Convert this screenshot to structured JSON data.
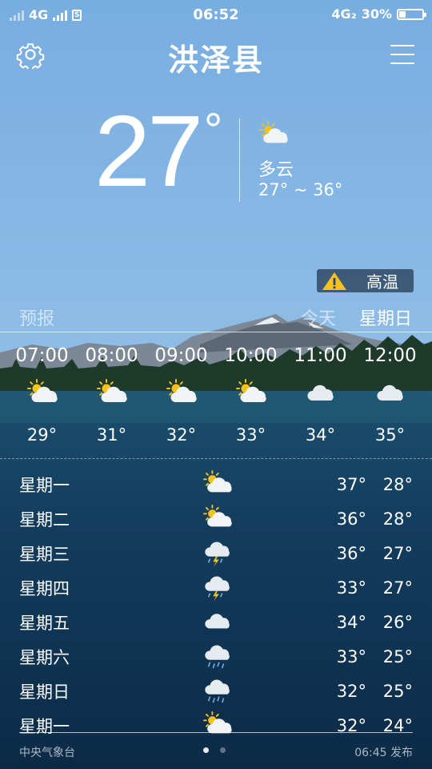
{
  "status": {
    "network_left": "4G",
    "time": "06:52",
    "network_right": "4G₂",
    "battery_percent": "30%",
    "battery_level": 0.3,
    "sim_glyph": "S"
  },
  "header": {
    "city": "洪泽县",
    "settings_icon": "gear-icon",
    "menu_icon": "menu-icon"
  },
  "current": {
    "temp": "27",
    "deg": "°",
    "icon": "partly-cloudy-icon",
    "condition": "多云",
    "range": "27° ~ 36°"
  },
  "alert": {
    "label": "高温",
    "icon": "warning-icon"
  },
  "forecast": {
    "title": "预报",
    "today": "今天",
    "day": "星期日"
  },
  "hourly": [
    {
      "time": "07:00",
      "icon": "partly-cloudy-icon",
      "temp": "29°"
    },
    {
      "time": "08:00",
      "icon": "partly-cloudy-icon",
      "temp": "31°"
    },
    {
      "time": "09:00",
      "icon": "partly-cloudy-icon",
      "temp": "32°"
    },
    {
      "time": "10:00",
      "icon": "partly-cloudy-icon",
      "temp": "33°"
    },
    {
      "time": "11:00",
      "icon": "cloudy-icon",
      "temp": "34°"
    },
    {
      "time": "12:00",
      "icon": "cloudy-icon",
      "temp": "35°"
    }
  ],
  "daily": [
    {
      "day": "星期一",
      "icon": "partly-cloudy-icon",
      "high": "37°",
      "low": "28°"
    },
    {
      "day": "星期二",
      "icon": "partly-cloudy-icon",
      "high": "36°",
      "low": "28°"
    },
    {
      "day": "星期三",
      "icon": "thunderstorm-icon",
      "high": "36°",
      "low": "27°"
    },
    {
      "day": "星期四",
      "icon": "thunderstorm-icon",
      "high": "33°",
      "low": "27°"
    },
    {
      "day": "星期五",
      "icon": "cloudy-icon",
      "high": "34°",
      "low": "26°"
    },
    {
      "day": "星期六",
      "icon": "rain-icon",
      "high": "33°",
      "low": "25°"
    },
    {
      "day": "星期日",
      "icon": "rain-icon",
      "high": "32°",
      "low": "25°"
    },
    {
      "day": "星期一",
      "icon": "partly-cloudy-icon",
      "high": "32°",
      "low": "24°"
    }
  ],
  "footer": {
    "source": "中央气象台",
    "published": "06:45 发布",
    "pages": 2,
    "active_page": 1
  },
  "colors": {
    "sky_top": "#79aee0",
    "sky_bottom": "#a6cfef",
    "lake": "#0f3150",
    "alert_icon": "#f6c21c",
    "sun": "#f5c21b"
  }
}
